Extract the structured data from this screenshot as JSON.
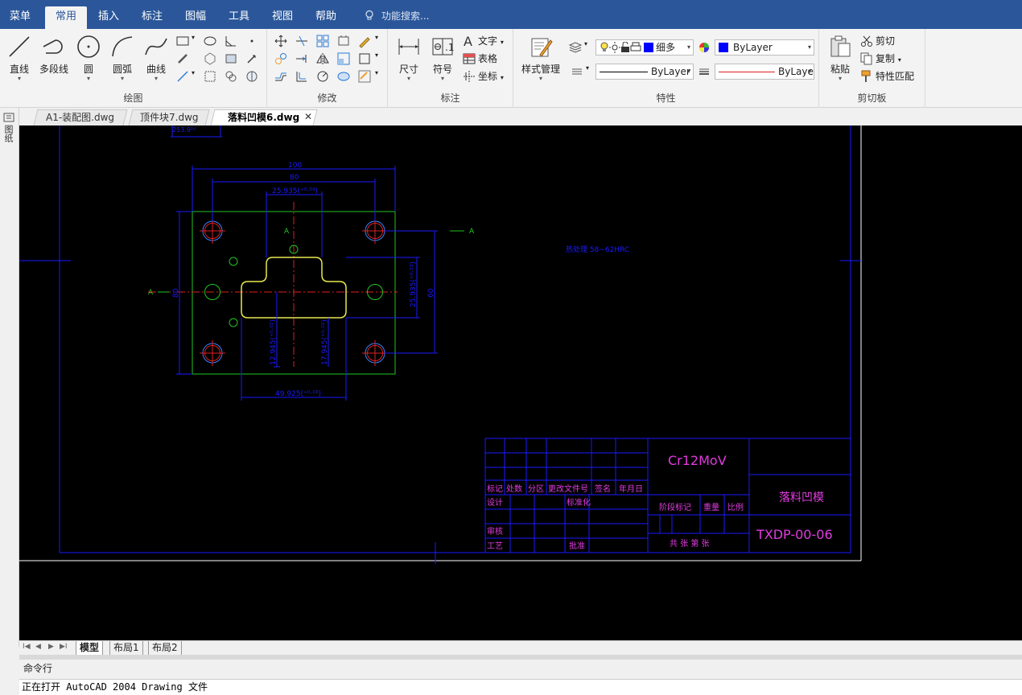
{
  "menu": {
    "items": [
      "菜单",
      "常用",
      "插入",
      "标注",
      "图幅",
      "工具",
      "视图",
      "帮助"
    ],
    "active": "常用",
    "search_placeholder": "功能搜索..."
  },
  "ribbon": {
    "draw": {
      "label": "绘图",
      "line": "直线",
      "polyline": "多段线",
      "circle": "圆",
      "arc": "圆弧",
      "curve": "曲线"
    },
    "modify": {
      "label": "修改"
    },
    "annotate": {
      "label": "标注",
      "dimension": "尺寸",
      "symbol": "符号",
      "text": "文字",
      "table": "表格",
      "coordinate": "坐标"
    },
    "properties": {
      "label": "特性",
      "style_manager": "样式管理",
      "layer_value": "细多",
      "color_value": "ByLayer",
      "linetype_value": "ByLayer",
      "lineweight_value": "ByLaye"
    },
    "clipboard": {
      "label": "剪切板",
      "paste": "粘贴",
      "cut": "剪切",
      "copy": "复制",
      "match": "特性匹配"
    }
  },
  "side_strip_label": "图纸",
  "file_tabs": [
    {
      "label": "A1-装配图.dwg",
      "active": false
    },
    {
      "label": "顶件块7.dwg",
      "active": false
    },
    {
      "label": "落料凹模6.dwg",
      "active": true
    }
  ],
  "tab_close": "✕",
  "drawing": {
    "dims": {
      "top_fragment": "253.9¹⁰",
      "d100": "100",
      "d80": "80",
      "d25": "25.935(⁺⁰·⁰³)",
      "d60": "60",
      "d80v": "80",
      "d25v": "25.935(⁺⁰·⁰³)",
      "d12": "12.945(⁺⁰·⁰²)",
      "d17": "17.945(⁺⁰·⁰²)",
      "d49": "49.925(⁺⁰·⁰³)"
    },
    "section_a": "A",
    "hardness_note": "热处理 58~62HRC",
    "title_block": {
      "material": "Cr12MoV",
      "part_name": "落料凹模",
      "drawing_no": "TXDP-00-06",
      "headers": [
        "标记",
        "处数",
        "分区",
        "更改文件号",
        "签名",
        "年月日"
      ],
      "design": "设计",
      "standardize": "标准化",
      "stage_mark": "阶段标记",
      "weight": "重量",
      "scale": "比例",
      "review": "审核",
      "process": "工艺",
      "approve": "批准",
      "sheets": "共  张 第  张"
    }
  },
  "layout_tabs": [
    {
      "label": "模型",
      "active": true
    },
    {
      "label": "布局1",
      "active": false
    },
    {
      "label": "布局2",
      "active": false
    }
  ],
  "command": {
    "label": "命令行",
    "output": "正在打开 AutoCAD 2004 Drawing 文件"
  }
}
